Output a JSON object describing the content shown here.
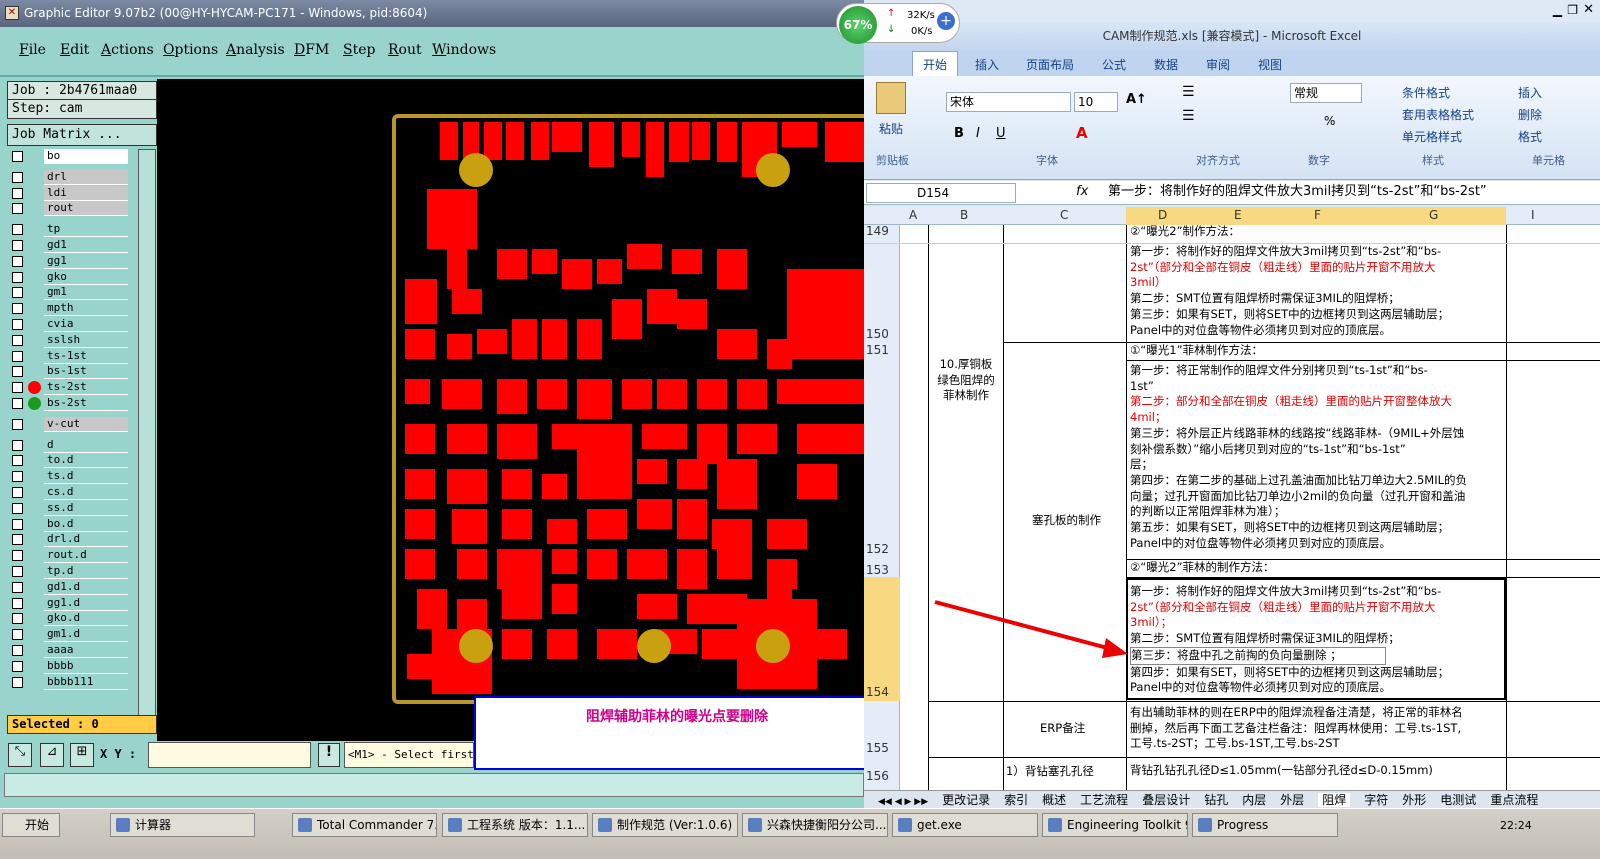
{
  "ge": {
    "title": "Graphic Editor 9.07b2 (00@HY-HYCAM-PC171 - Windows, pid:8604)",
    "menu": [
      "File",
      "Edit",
      "Actions",
      "Options",
      "Analysis",
      "DFM",
      "Step",
      "Rout",
      "Windows"
    ],
    "job": "Job : 2b4761maa0",
    "step": "Step: cam",
    "job_matrix": "Job Matrix ...",
    "layers": [
      "bo",
      "drl",
      "ldi",
      "rout",
      "tp",
      "gd1",
      "gg1",
      "gko",
      "gm1",
      "mpth",
      "cvia",
      "sslsh",
      "ts-1st",
      "bs-1st",
      "ts-2st",
      "bs-2st",
      "v-cut",
      "d",
      "to.d",
      "ts.d",
      "cs.d",
      "ss.d",
      "bo.d",
      "drl.d",
      "rout.d",
      "tp.d",
      "gd1.d",
      "gg1.d",
      "gko.d",
      "gm1.d",
      "aaaa",
      "bbbb",
      "bbbb111"
    ],
    "selected": "Selected : 0",
    "xy_label": "X Y :",
    "status": "<M1> - Select first",
    "note": "阻焊辅助菲林的曝光点要删除"
  },
  "net": {
    "pct": "67%",
    "up": "32K/s",
    "down": "0K/s"
  },
  "xl": {
    "title": "CAM制作规范.xls [兼容模式] - Microsoft Excel",
    "tabs": [
      "开始",
      "插入",
      "页面布局",
      "公式",
      "数据",
      "审阅",
      "视图"
    ],
    "font": "宋体",
    "size": "10",
    "format": "常规",
    "ribbon": {
      "paste": "粘贴",
      "cond": "条件格式",
      "table": "套用表格格式",
      "cellstyle": "单元格样式",
      "insert": "插入",
      "delete": "删除",
      "fmt": "格式"
    },
    "groups": [
      "剪贴板",
      "字体",
      "对齐方式",
      "数字",
      "样式",
      "单元格"
    ],
    "namebox": "D154",
    "fx": "第一步：将制作好的阻焊文件放大3mil拷贝到“ts-2st”和“bs-2st”",
    "cols": [
      "A",
      "B",
      "C",
      "D",
      "E",
      "F",
      "G",
      "I"
    ],
    "rows": [
      "149",
      "150",
      "151",
      "152",
      "153",
      "154",
      "155",
      "156"
    ],
    "b_label": [
      "10.厚铜板",
      "绿色阻焊的",
      "菲林制作"
    ],
    "c_plug": "塞孔板的制作",
    "c_erp": "ERP备注",
    "c_back": "1）背钻塞孔孔径",
    "d149": "②“曝光2”制作方法：",
    "d150": [
      "第一步：将制作好的阻焊文件放大3mil拷贝到“ts-2st”和“bs-",
      "2st”（部分和全部在铜皮（粗走线）里面的贴片开窗不用放大",
      "3mil）",
      "第二步：SMT位置有阻焊桥时需保证3MIL的阻焊桥；",
      "第三步：如果有SET，则将SET中的边框拷贝到这两层辅助层；",
      "Panel中的对位盘等物件必须拷贝到对应的顶底层。"
    ],
    "d151": "①“曝光1”菲林制作方法：",
    "d152": [
      "第一步：将正常制作的阻焊文件分别拷贝到“ts-1st”和“bs-",
      "1st”",
      "第二步：部分和全部在铜皮（粗走线）里面的贴片开窗整体放大",
      "4mil；",
      "第三步：将外层正片线路菲林的线路按“线路菲林-（9MIL+外层蚀",
      "刻补偿系数）”缩小后拷贝到对应的“ts-1st”和“bs-1st”",
      "层；",
      "第四步：在第二步的基础上过孔盖油面加比钻刀单边大2.5MIL的负",
      "向量；过孔开窗面加比钻刀单边小2mil的负向量（过孔开窗和盖油",
      "的判断以正常阻焊菲林为准）；",
      "第五步：如果有SET，则将SET中的边框拷贝到这两层辅助层；",
      "Panel中的对位盘等物件必须拷贝到对应的顶底层。"
    ],
    "d153": "②“曝光2”菲林的制作方法：",
    "d154": [
      "第一步：将制作好的阻焊文件放大3mil拷贝到“ts-2st”和“bs-",
      "2st”（部分和全部在铜皮（粗走线）里面的贴片开窗不用放大",
      "3mil）；",
      "第二步：SMT位置有阻焊桥时需保证3MIL的阻焊桥；",
      "第三步：将盘中孔之前掏的负向量删除  ；",
      "第四步：如果有SET，则将SET中的边框拷贝到这两层辅助层；",
      "Panel中的对位盘等物件必须拷贝到对应的顶底层。"
    ],
    "d155": [
      "有出辅助菲林的则在ERP中的阻焊流程备注清楚，将正常的菲林名",
      "删掉，然后再下面工艺备注栏备注：阻焊再林使用：工号.ts-1ST,",
      "工号.ts-2ST；工号.bs-1ST,工号.bs-2ST"
    ],
    "d156": "背钻孔钻孔孔径D≤1.05mm(一钻部分孔径d≤D-0.15mm)",
    "sheets": [
      "更改记录",
      "索引",
      "概述",
      "工艺流程",
      "叠层设计",
      "钻孔",
      "内层",
      "外层",
      "阻焊",
      "字符",
      "外形",
      "电测试",
      "重点流程"
    ]
  },
  "taskbar": {
    "start": "开始",
    "items": [
      "计算器",
      "Total Commander 7.0 ...",
      "工程系统  版本：1.1...",
      "制作规范 (Ver:1.0.6)",
      "兴森快捷衡阳分公司...",
      "get.exe",
      "Engineering Toolkit 9.0...",
      "Progress"
    ],
    "time": "22:24"
  }
}
